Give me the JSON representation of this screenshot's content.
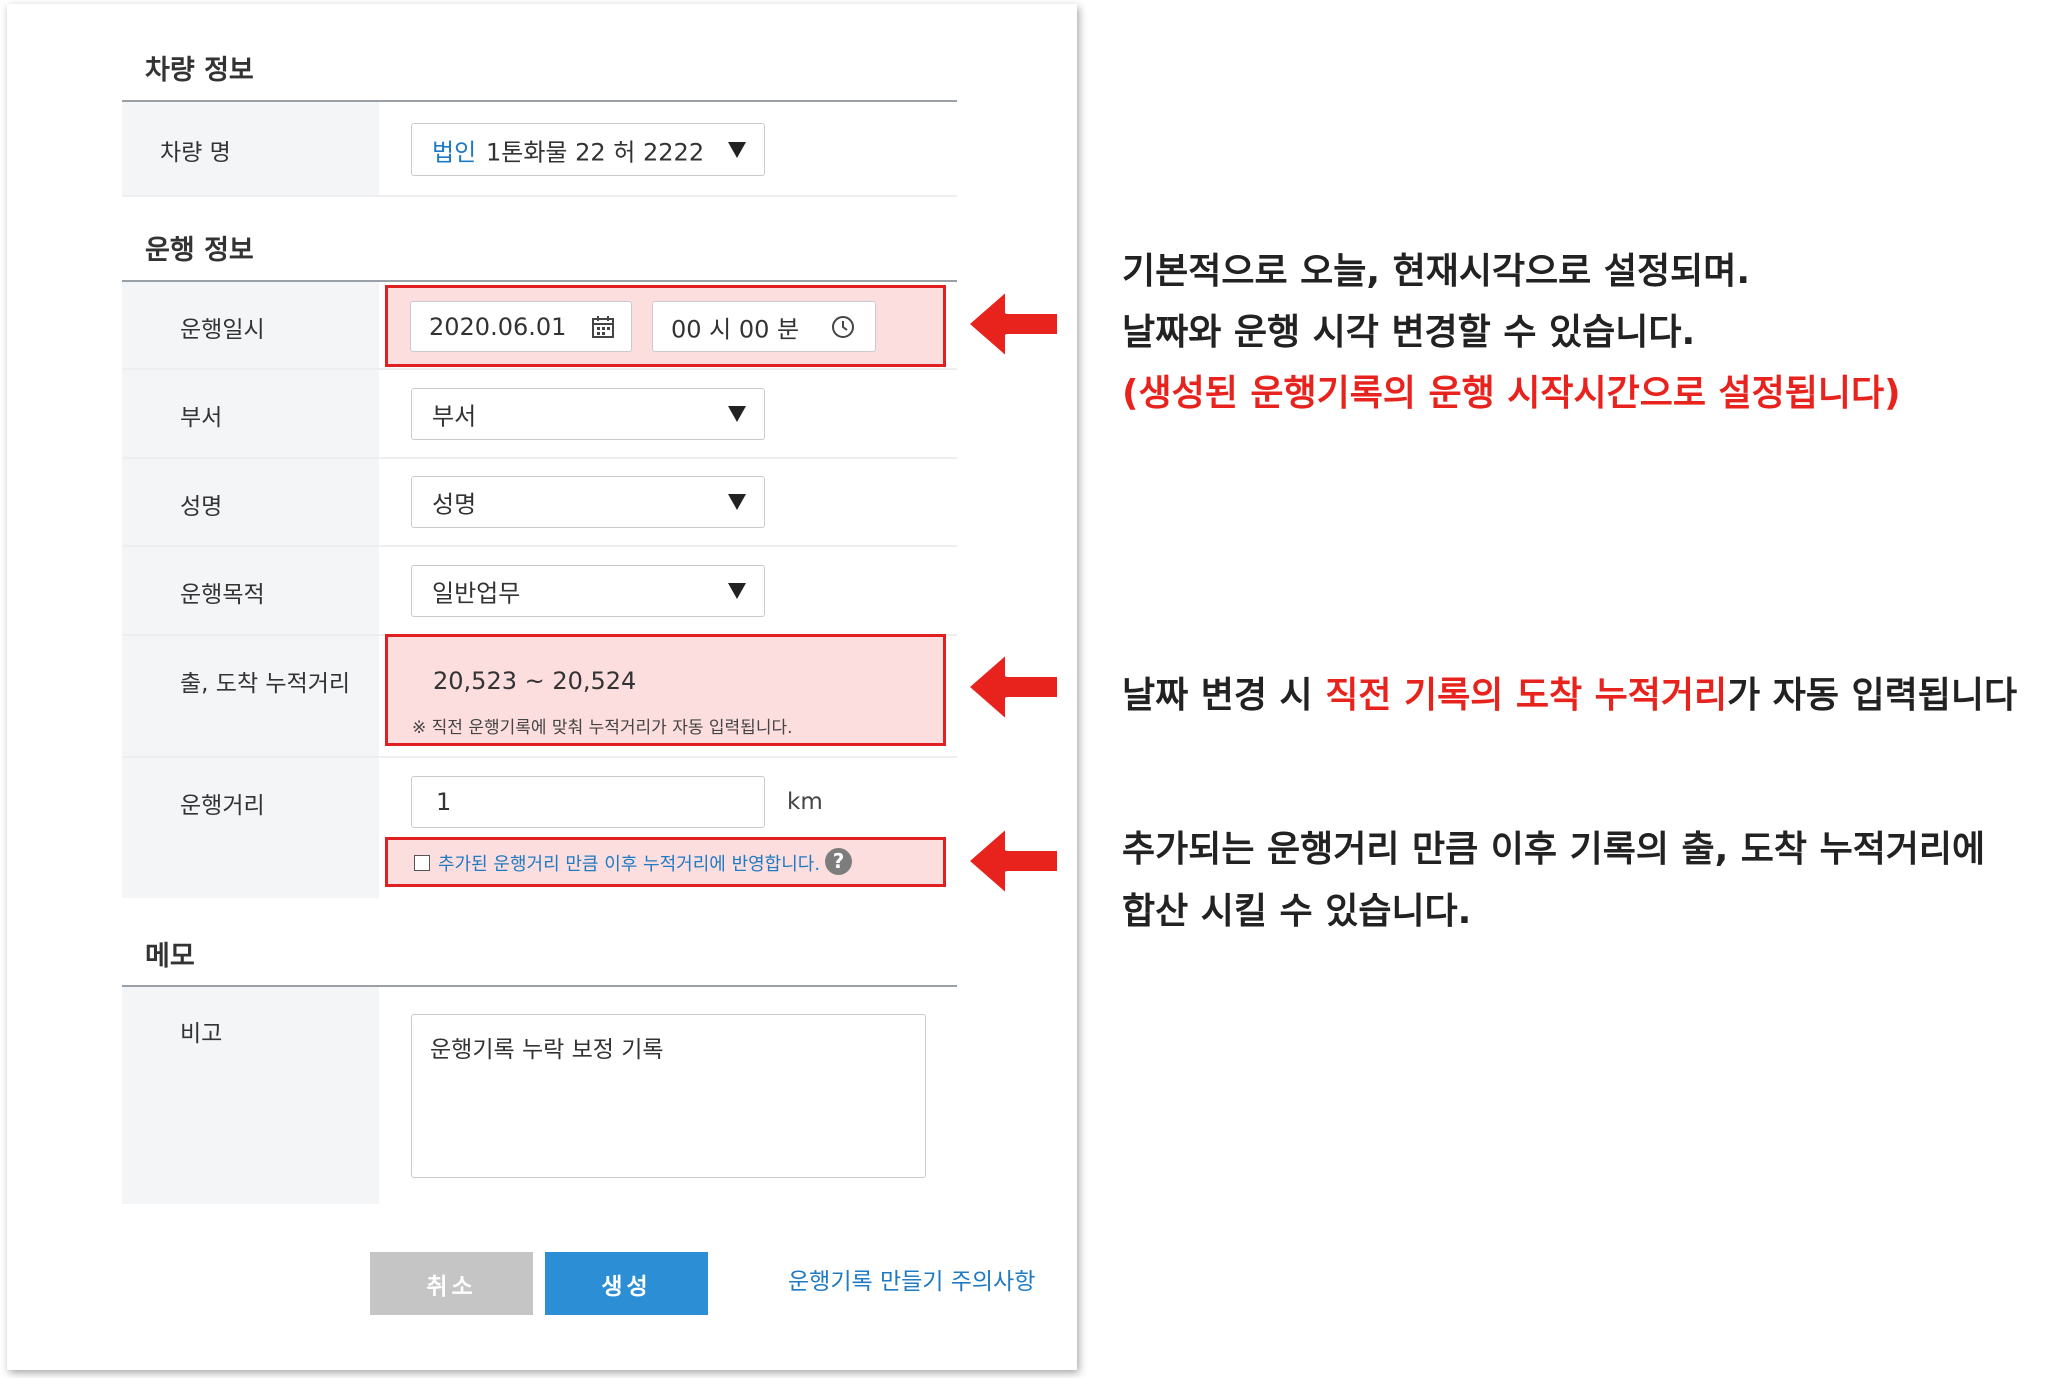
{
  "vehicle": {
    "section_title": "차량 정보",
    "label": "차량 명",
    "select_tag": "법인",
    "select_value": "1톤화물  22 허 2222"
  },
  "trip": {
    "section_title": "운행 정보",
    "datetime_label": "운행일시",
    "date_value": "2020.06.01",
    "time_value": "00 시 00 분",
    "dept_label": "부서",
    "dept_value": "부서",
    "name_label": "성명",
    "name_value": "성명",
    "purpose_label": "운행목적",
    "purpose_value": "일반업무",
    "odometer_label": "출, 도착 누적거리",
    "odometer_value": "20,523  ~ 20,524",
    "odometer_note": "※ 직전 운행기록에 맞춰 누적거리가 자동 입력됩니다.",
    "distance_label": "운행거리",
    "distance_value": "1",
    "distance_unit": "km",
    "apply_checkbox_label": "추가된 운행거리 만큼 이후 누적거리에 반영합니다.",
    "help_glyph": "?"
  },
  "memo": {
    "section_title": "메모",
    "label": "비고",
    "value": "운행기록 누락 보정 기록"
  },
  "buttons": {
    "cancel": "취소",
    "create": "생성",
    "caution_link": "운행기록 만들기 주의사항"
  },
  "notes": {
    "note1_line1": "기본적으로 오늘, 현재시각으로 설정되며.",
    "note1_line2": "날짜와 운행 시각 변경할 수 있습니다.",
    "note1_line3": "(생성된 운행기록의 운행 시작시간으로 설정됩니다)",
    "note2_pre": "날짜 변경 시 ",
    "note2_red": "직전 기록의 도착 누적거리",
    "note2_post": "가 자동 입력됩니다",
    "note3_line1": "추가되는 운행거리 만큼 이후 기록의 출, 도착 누적거리에",
    "note3_line2": "합산 시킬 수 있습니다."
  },
  "icons": {
    "calendar": "calendar-icon",
    "clock": "clock-icon",
    "dropdown": "triangle-down-icon",
    "help": "question-circle-icon",
    "arrow": "arrow-left-icon"
  },
  "colors": {
    "primary": "#2c8fd6",
    "highlight_border": "#e02020",
    "highlight_fill": "#fcdede",
    "cancel_button": "#c5c5c5",
    "note_red": "#e8231d",
    "link": "#1f7ac4"
  }
}
